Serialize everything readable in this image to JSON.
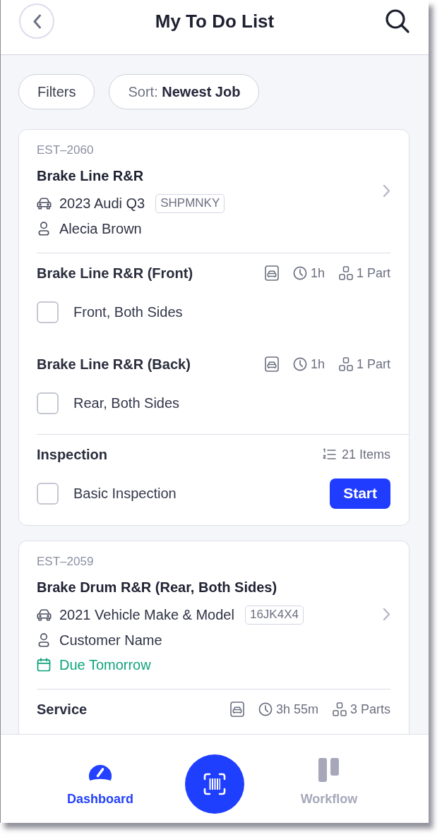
{
  "header": {
    "title": "My To Do List"
  },
  "filters": [
    {
      "label": "Filters"
    },
    {
      "label": "Sort:",
      "value": "Newest Job"
    }
  ],
  "jobs": [
    {
      "estimate": "EST–2060",
      "title": "Brake Line R&R",
      "vehicle": "2023 Audi Q3",
      "plate": "SHPMNKY",
      "customer": "Alecia Brown",
      "sections": [
        {
          "kind": "service",
          "title": "Brake Line R&R (Front)",
          "time": "1h",
          "parts": "1 Part",
          "tasks": [
            {
              "label": "Front, Both Sides",
              "checked": false
            }
          ]
        },
        {
          "kind": "service",
          "title": "Brake Line R&R (Back)",
          "time": "1h",
          "parts": "1 Part",
          "tasks": [
            {
              "label": "Rear, Both Sides",
              "checked": false
            }
          ]
        },
        {
          "kind": "inspection",
          "title": "Inspection",
          "items": "21 Items",
          "tasks": [
            {
              "label": "Basic Inspection",
              "checked": false,
              "action": "Start"
            }
          ]
        }
      ]
    },
    {
      "estimate": "EST–2059",
      "title": "Brake Drum R&R (Rear, Both Sides)",
      "vehicle": "2021 Vehicle Make & Model",
      "plate": "16JK4X4",
      "customer": "Customer Name",
      "due": "Due Tomorrow",
      "sections": [
        {
          "kind": "service",
          "title": "Service",
          "time": "3h 55m",
          "parts": "3 Parts"
        }
      ]
    }
  ],
  "nav": {
    "tabs": [
      {
        "label": "Dashboard",
        "selected": true,
        "kind": "dashboard"
      },
      {
        "label": "Workflow",
        "selected": false,
        "kind": "workflow"
      }
    ]
  }
}
